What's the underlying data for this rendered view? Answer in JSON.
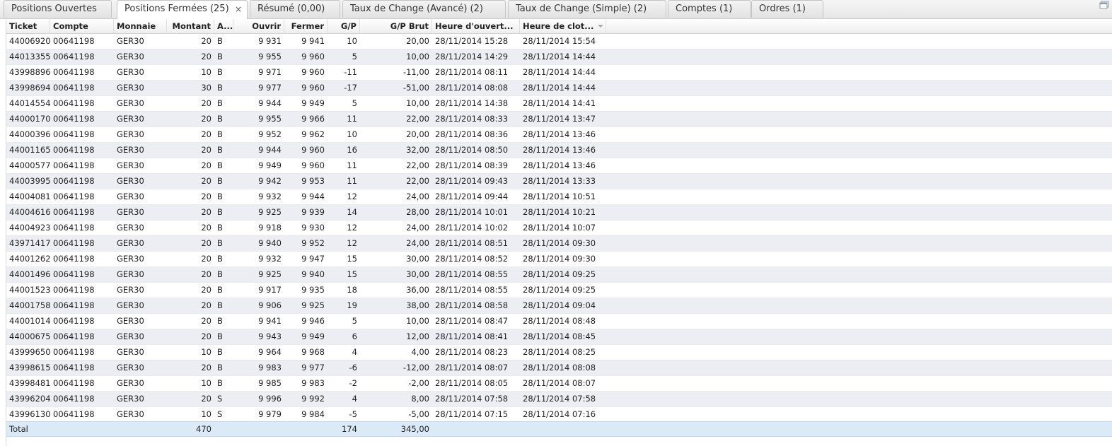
{
  "tabs": [
    {
      "label": "Positions Ouvertes",
      "active": false,
      "closable": false
    },
    {
      "label": "Positions Fermées (25)",
      "active": true,
      "closable": true
    },
    {
      "label": "Résumé (0,00)",
      "active": false,
      "closable": false
    },
    {
      "label": "Taux de Change (Avancé) (2)",
      "active": false,
      "closable": false
    },
    {
      "label": "Taux de Change (Simple) (2)",
      "active": false,
      "closable": false
    },
    {
      "label": "Comptes (1)",
      "active": false,
      "closable": false
    },
    {
      "label": "Ordres (1)",
      "active": false,
      "closable": false
    }
  ],
  "tab_close_glyph": "×",
  "columns": [
    "Ticket",
    "Compte",
    "Monnaie",
    "Montant",
    "A...",
    "Ouvrir",
    "Fermer",
    "G/P",
    "G/P Brut",
    "Heure d'ouvert...",
    "Heure de clot..."
  ],
  "sorted_column_icon": "sort-descending-icon",
  "rows": [
    [
      "44006920",
      "00641198",
      "GER30",
      "20",
      "B",
      "9 931",
      "9 941",
      "10",
      "20,00",
      "28/11/2014 15:28",
      "28/11/2014 15:54"
    ],
    [
      "44013355",
      "00641198",
      "GER30",
      "20",
      "B",
      "9 955",
      "9 960",
      "5",
      "10,00",
      "28/11/2014 14:29",
      "28/11/2014 14:44"
    ],
    [
      "43998896",
      "00641198",
      "GER30",
      "10",
      "B",
      "9 971",
      "9 960",
      "-11",
      "-11,00",
      "28/11/2014 08:11",
      "28/11/2014 14:44"
    ],
    [
      "43998694",
      "00641198",
      "GER30",
      "30",
      "B",
      "9 977",
      "9 960",
      "-17",
      "-51,00",
      "28/11/2014 08:08",
      "28/11/2014 14:44"
    ],
    [
      "44014554",
      "00641198",
      "GER30",
      "20",
      "B",
      "9 944",
      "9 949",
      "5",
      "10,00",
      "28/11/2014 14:38",
      "28/11/2014 14:41"
    ],
    [
      "44000170",
      "00641198",
      "GER30",
      "20",
      "B",
      "9 955",
      "9 966",
      "11",
      "22,00",
      "28/11/2014 08:33",
      "28/11/2014 13:47"
    ],
    [
      "44000396",
      "00641198",
      "GER30",
      "20",
      "B",
      "9 952",
      "9 962",
      "10",
      "20,00",
      "28/11/2014 08:36",
      "28/11/2014 13:46"
    ],
    [
      "44001165",
      "00641198",
      "GER30",
      "20",
      "B",
      "9 944",
      "9 960",
      "16",
      "32,00",
      "28/11/2014 08:50",
      "28/11/2014 13:46"
    ],
    [
      "44000577",
      "00641198",
      "GER30",
      "20",
      "B",
      "9 949",
      "9 960",
      "11",
      "22,00",
      "28/11/2014 08:39",
      "28/11/2014 13:46"
    ],
    [
      "44003995",
      "00641198",
      "GER30",
      "20",
      "B",
      "9 942",
      "9 953",
      "11",
      "22,00",
      "28/11/2014 09:43",
      "28/11/2014 13:33"
    ],
    [
      "44004081",
      "00641198",
      "GER30",
      "20",
      "B",
      "9 932",
      "9 944",
      "12",
      "24,00",
      "28/11/2014 09:44",
      "28/11/2014 10:51"
    ],
    [
      "44004616",
      "00641198",
      "GER30",
      "20",
      "B",
      "9 925",
      "9 939",
      "14",
      "28,00",
      "28/11/2014 10:01",
      "28/11/2014 10:21"
    ],
    [
      "44004923",
      "00641198",
      "GER30",
      "20",
      "B",
      "9 918",
      "9 930",
      "12",
      "24,00",
      "28/11/2014 10:02",
      "28/11/2014 10:07"
    ],
    [
      "43971417",
      "00641198",
      "GER30",
      "20",
      "B",
      "9 940",
      "9 952",
      "12",
      "24,00",
      "28/11/2014 08:51",
      "28/11/2014 09:30"
    ],
    [
      "44001262",
      "00641198",
      "GER30",
      "20",
      "B",
      "9 932",
      "9 947",
      "15",
      "30,00",
      "28/11/2014 08:52",
      "28/11/2014 09:30"
    ],
    [
      "44001496",
      "00641198",
      "GER30",
      "20",
      "B",
      "9 925",
      "9 940",
      "15",
      "30,00",
      "28/11/2014 08:55",
      "28/11/2014 09:25"
    ],
    [
      "44001523",
      "00641198",
      "GER30",
      "20",
      "B",
      "9 917",
      "9 935",
      "18",
      "36,00",
      "28/11/2014 08:55",
      "28/11/2014 09:25"
    ],
    [
      "44001758",
      "00641198",
      "GER30",
      "20",
      "B",
      "9 906",
      "9 925",
      "19",
      "38,00",
      "28/11/2014 08:58",
      "28/11/2014 09:04"
    ],
    [
      "44001014",
      "00641198",
      "GER30",
      "20",
      "B",
      "9 941",
      "9 946",
      "5",
      "10,00",
      "28/11/2014 08:47",
      "28/11/2014 08:48"
    ],
    [
      "44000675",
      "00641198",
      "GER30",
      "20",
      "B",
      "9 943",
      "9 949",
      "6",
      "12,00",
      "28/11/2014 08:41",
      "28/11/2014 08:45"
    ],
    [
      "43999650",
      "00641198",
      "GER30",
      "10",
      "B",
      "9 964",
      "9 968",
      "4",
      "4,00",
      "28/11/2014 08:23",
      "28/11/2014 08:25"
    ],
    [
      "43998615",
      "00641198",
      "GER30",
      "20",
      "B",
      "9 983",
      "9 977",
      "-6",
      "-12,00",
      "28/11/2014 08:07",
      "28/11/2014 08:08"
    ],
    [
      "43998481",
      "00641198",
      "GER30",
      "10",
      "B",
      "9 985",
      "9 983",
      "-2",
      "-2,00",
      "28/11/2014 08:05",
      "28/11/2014 08:07"
    ],
    [
      "43996204",
      "00641198",
      "GER30",
      "20",
      "S",
      "9 996",
      "9 992",
      "4",
      "8,00",
      "28/11/2014 07:58",
      "28/11/2014 07:58"
    ],
    [
      "43996130",
      "00641198",
      "GER30",
      "10",
      "S",
      "9 979",
      "9 984",
      "-5",
      "-5,00",
      "28/11/2014 07:15",
      "28/11/2014 07:16"
    ]
  ],
  "totals": {
    "label": "Total",
    "montant": "470",
    "gp": "174",
    "gp_brut": "345,00"
  }
}
